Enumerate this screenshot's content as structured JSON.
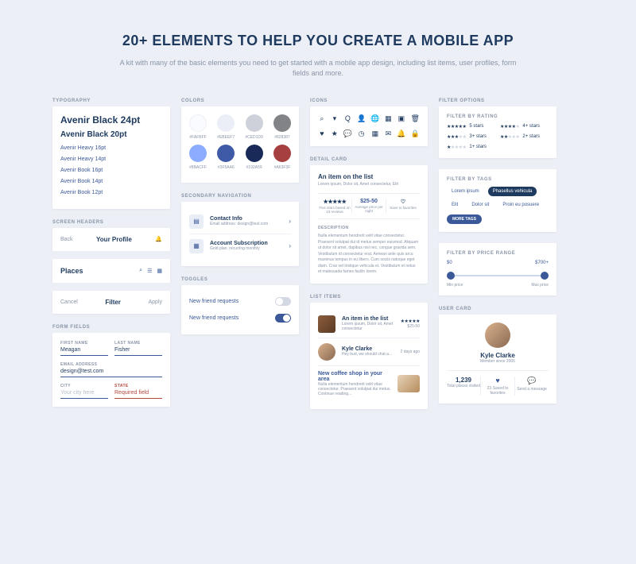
{
  "hero": {
    "title": "20+ ELEMENTS TO HELP YOU CREATE A MOBILE APP",
    "subtitle": "A kit with many of the basic elements you need to get started with a mobile app design, including list items, user profiles, form fields and more."
  },
  "typography": {
    "label": "TYPOGRAPHY",
    "t24": "Avenir Black 24pt",
    "t20": "Avenir Black 20pt",
    "items": [
      "Avenir Heavy 16pt",
      "Avenir Heavy 14pt",
      "Avenir Book 16pt",
      "Avenir Book 14pt",
      "Avenir Book 12pt"
    ]
  },
  "screen_headers": {
    "label": "SCREEN HEADERS",
    "h1": {
      "back": "Back",
      "title": "Your Profile"
    },
    "h2": {
      "title": "Places"
    },
    "h3": {
      "cancel": "Cancel",
      "title": "Filter",
      "apply": "Apply"
    }
  },
  "form_fields": {
    "label": "FORM FIELDS",
    "first_name": {
      "label": "FIRST NAME",
      "value": "Meagan"
    },
    "last_name": {
      "label": "LAST NAME",
      "value": "Fisher"
    },
    "email": {
      "label": "EMAIL ADDRESS",
      "value": "design@test.com"
    },
    "city": {
      "label": "CITY",
      "placeholder": "Your city here"
    },
    "state": {
      "label": "STATE",
      "placeholder": "Required field"
    }
  },
  "colors": {
    "label": "COLORS",
    "row1": [
      {
        "hex": "#FAFBFF"
      },
      {
        "hex": "#EBEEF7"
      },
      {
        "hex": "#CED1D9"
      },
      {
        "hex": "#828387"
      }
    ],
    "row2": [
      {
        "hex": "#8BACFF"
      },
      {
        "hex": "#3F5AA6"
      },
      {
        "hex": "#192A59"
      },
      {
        "hex": "#A63F3F"
      }
    ]
  },
  "secondary_nav": {
    "label": "SECONDARY NAVIGATION",
    "items": [
      {
        "title": "Contact Info",
        "sub": "Email address: design@test.com"
      },
      {
        "title": "Account Subscription",
        "sub": "Gold plan, recurring monthly"
      }
    ]
  },
  "toggles": {
    "label": "TOGGLES",
    "items": [
      {
        "label": "New friend requests",
        "on": false
      },
      {
        "label": "New friend requests",
        "on": true
      }
    ]
  },
  "icons": {
    "label": "ICONS"
  },
  "detail_card": {
    "label": "DETAIL CARD",
    "title": "An item on the list",
    "sub": "Lorem ipsum, Dolor sit, Amet consectetur, Elit",
    "stat1": {
      "val": "★★★★★",
      "lab": "Five stars based on 23 reviews"
    },
    "stat2": {
      "val": "$25-50",
      "lab": "Average price per night"
    },
    "stat3": {
      "val": "♡",
      "lab": "Save to favorites"
    },
    "desc_h": "DESCRIPTION",
    "desc": "Nulla elementum hendrerit velit vitae consectetur. Praesent volutpat dui id metus semper euismod. Aliquam ut dolor sit amet, dapibus nisl nec, congue gravida sem. Vestibulum id consectetur erat. Aenean ante quis arcu maximus tempus in eu libero. Cum sociis natoque eget diam. Cras vel tristique vehicula et. Vestibulum et netus et malesuada fames facilin lorem."
  },
  "list_items": {
    "label": "LIST ITEMS",
    "item1": {
      "title": "An item in the list",
      "sub": "Lorem ipsum, Dolor sit, Amet consectetur",
      "price": "$25-50"
    },
    "item2": {
      "title": "Kyle Clarke",
      "sub": "Hey bud, we should chat a...",
      "time": "2 days ago"
    },
    "item3": {
      "title": "New coffee shop in your area",
      "sub": "Nulla elementum hendrerit velit vitae consectetur. Praesent volutpat dui metus. Continue reading..."
    }
  },
  "filter_rating": {
    "label": "FILTER OPTIONS",
    "section": "FILTER BY RATING",
    "items": [
      {
        "stars": 5,
        "label": "5 stars"
      },
      {
        "stars": 4,
        "label": "4+ stars"
      },
      {
        "stars": 3,
        "label": "3+ stars"
      },
      {
        "stars": 2,
        "label": "2+ stars"
      },
      {
        "stars": 1,
        "label": "1+ stars"
      }
    ]
  },
  "filter_tags": {
    "section": "FILTER BY TAGS",
    "tags": [
      "Lorem ipsum",
      "Phasellus vehicula",
      "Elit",
      "Dolor sit",
      "Proin eu posuere"
    ],
    "active_index": 1,
    "more": "MORE TAGS"
  },
  "filter_price": {
    "section": "FILTER BY PRICE RANGE",
    "min_val": "$0",
    "max_val": "$700+",
    "min_label": "Min price",
    "max_label": "Max price"
  },
  "user_card": {
    "label": "USER CARD",
    "name": "Kyle Clarke",
    "since": "Member since 2005",
    "stat1": {
      "num": "1,239",
      "lab": "Total places visited"
    },
    "stat2": {
      "lab": "23 Saved to favorites"
    },
    "stat3": {
      "lab": "Send a message"
    }
  }
}
